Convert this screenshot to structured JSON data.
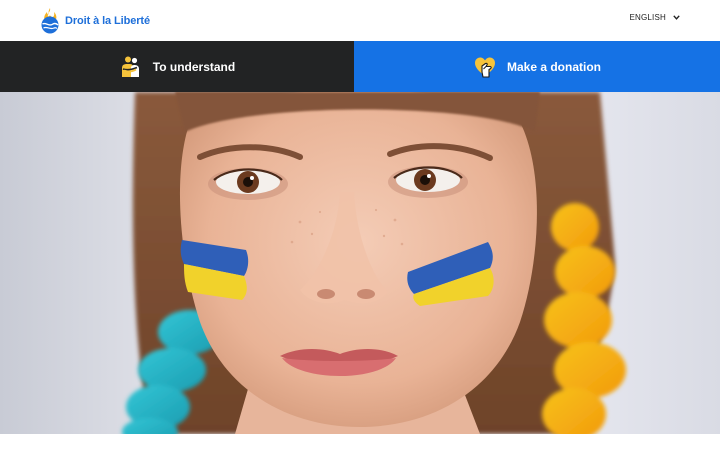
{
  "header": {
    "logo_text": "Droit à la Liberté",
    "logo_icon": "flame-globe-icon",
    "language": "ENGLISH",
    "language_icon": "chevron-down-icon"
  },
  "nav": {
    "items": [
      {
        "label": "To understand",
        "icon": "hug-icon",
        "background": "#222324"
      },
      {
        "label": "Make a donation",
        "icon": "heart-hand-icon",
        "background": "#1572e5"
      }
    ]
  },
  "hero": {
    "image": "girl-with-ukrainian-flag-face-paint"
  },
  "colors": {
    "brand_blue": "#1e6fd9",
    "nav_dark": "#222324",
    "nav_blue": "#1572e5",
    "icon_yellow": "#f6c33b",
    "flag_blue": "#2f5fb8",
    "flag_yellow": "#f1d22b"
  }
}
